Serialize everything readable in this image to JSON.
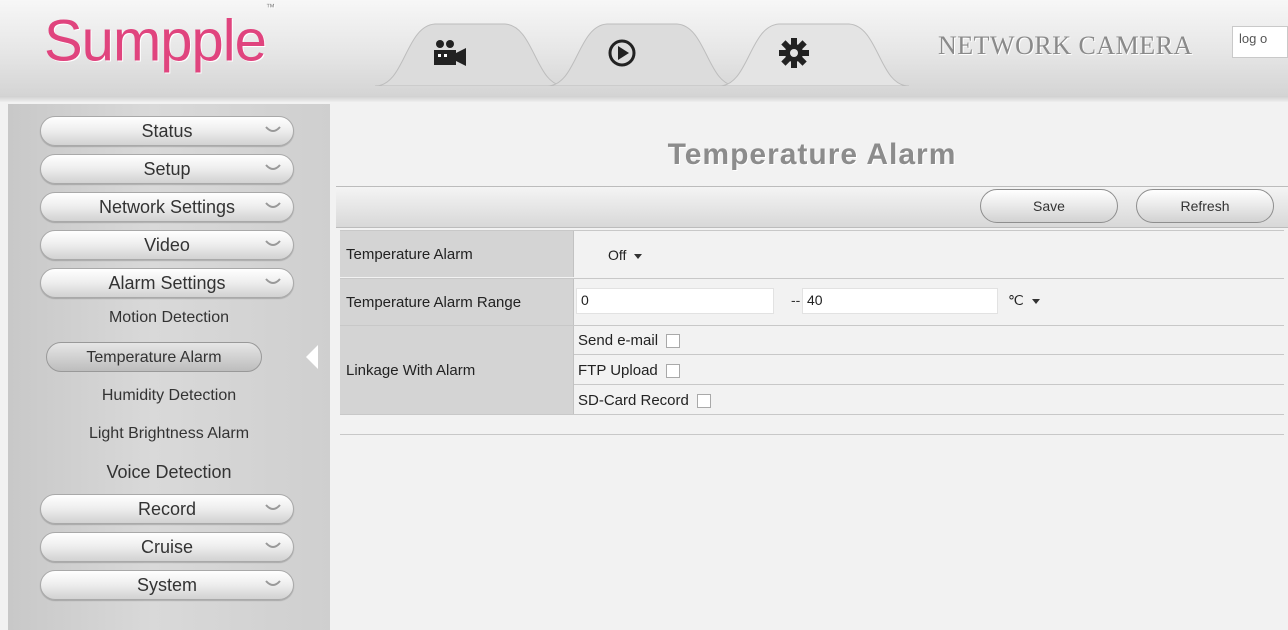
{
  "header": {
    "logo": "Sumpple",
    "logo_tm": "™",
    "brand": "NETWORK CAMERA",
    "logout": "log o",
    "tabs": [
      {
        "icon": "video-camera-icon"
      },
      {
        "icon": "play-icon"
      },
      {
        "icon": "gear-icon"
      }
    ]
  },
  "sidebar": {
    "items": [
      {
        "label": "Status"
      },
      {
        "label": "Setup"
      },
      {
        "label": "Network Settings"
      },
      {
        "label": "Video"
      },
      {
        "label": "Alarm Settings"
      }
    ],
    "sub_items": [
      {
        "label": "Motion Detection"
      },
      {
        "label": "Temperature Alarm"
      },
      {
        "label": "Humidity Detection"
      },
      {
        "label": "Light Brightness Alarm"
      },
      {
        "label": "Voice Detection"
      }
    ],
    "items_bottom": [
      {
        "label": "Record"
      },
      {
        "label": "Cruise"
      },
      {
        "label": "System"
      }
    ]
  },
  "main": {
    "title": "Temperature Alarm",
    "save_label": "Save",
    "refresh_label": "Refresh",
    "rows": {
      "alarm_label": "Temperature Alarm",
      "alarm_value": "Off",
      "range_label": "Temperature Alarm Range",
      "range_min": "0",
      "range_sep": "--",
      "range_max": "40",
      "unit": "℃",
      "linkage_label": "Linkage With Alarm",
      "email_label": "Send e-mail",
      "ftp_label": "FTP Upload",
      "sd_label": "SD-Card Record"
    }
  }
}
